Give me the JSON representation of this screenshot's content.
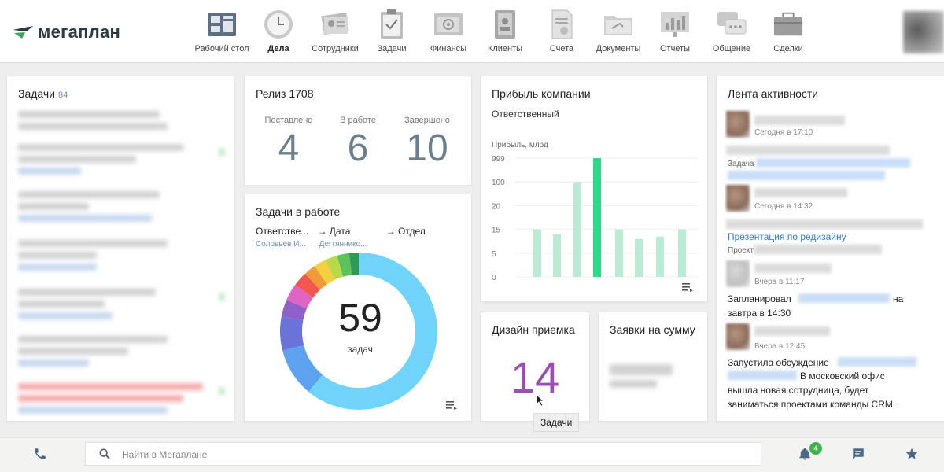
{
  "app": {
    "logo_text": "мегаплан"
  },
  "nav": {
    "items": [
      {
        "label": "Рабочий стол",
        "icon": "desktop-icon"
      },
      {
        "label": "Дела",
        "icon": "clock-icon",
        "active": true
      },
      {
        "label": "Сотрудники",
        "icon": "employees-icon"
      },
      {
        "label": "Задачи",
        "icon": "clipboard-icon"
      },
      {
        "label": "Финансы",
        "icon": "safe-icon"
      },
      {
        "label": "Клиенты",
        "icon": "contacts-icon"
      },
      {
        "label": "Счета",
        "icon": "invoice-icon"
      },
      {
        "label": "Документы",
        "icon": "folder-icon"
      },
      {
        "label": "Отчеты",
        "icon": "report-chart-icon"
      },
      {
        "label": "Общение",
        "icon": "chat-icon"
      },
      {
        "label": "Сделки",
        "icon": "briefcase-icon"
      }
    ]
  },
  "tasks_card": {
    "title": "Задачи",
    "count": "84"
  },
  "release_card": {
    "title": "Релиз 1708",
    "stats": [
      {
        "label": "Поставлено",
        "value": "4"
      },
      {
        "label": "В работе",
        "value": "6"
      },
      {
        "label": "Завершено",
        "value": "10"
      }
    ]
  },
  "work_card": {
    "title": "Задачи в работе",
    "col1": "Ответстве...",
    "col2": "→ Дата",
    "col3": "→ Отдел",
    "sub1": "Соловьев И...",
    "sub2": "Дегтяннико...",
    "total": "59",
    "unit": "задач"
  },
  "profit_card": {
    "title": "Прибыль компании",
    "subtitle": "Ответственный",
    "ylabel": "Прибыль, млрд"
  },
  "chart_data": {
    "type": "bar",
    "title": "Прибыль компании",
    "ylabel": "Прибыль, млрд",
    "y_ticks": [
      "999",
      "100",
      "20",
      "15",
      "5",
      "0"
    ],
    "values": [
      15,
      13,
      100,
      999,
      15,
      11,
      12,
      15
    ],
    "colors": [
      "#b9ecd2",
      "#b9ecd2",
      "#b9ecd2",
      "#2ed889",
      "#b9ecd2",
      "#b9ecd2",
      "#b9ecd2",
      "#b9ecd2"
    ],
    "grid": true
  },
  "donut_data": {
    "type": "pie",
    "segments": [
      {
        "value": 61.0,
        "color": "#6fd3fa"
      },
      {
        "value": 10.0,
        "color": "#5da2ee"
      },
      {
        "value": 7.0,
        "color": "#6a74d8"
      },
      {
        "value": 3.5,
        "color": "#8f61c8"
      },
      {
        "value": 3.5,
        "color": "#e064c4"
      },
      {
        "value": 3.0,
        "color": "#f2564e"
      },
      {
        "value": 2.5,
        "color": "#f29a3a"
      },
      {
        "value": 2.5,
        "color": "#f4d03f"
      },
      {
        "value": 2.5,
        "color": "#b8d94a"
      },
      {
        "value": 2.5,
        "color": "#5cc35a"
      },
      {
        "value": 2.0,
        "color": "#2f9a55"
      }
    ]
  },
  "design_card": {
    "title": "Дизайн приемка",
    "value": "14",
    "tooltip": "Задачи"
  },
  "sum_card": {
    "title": "Заявки на сумму"
  },
  "feed": {
    "title": "Лента активности",
    "time1": "Сегодня в 17:10",
    "task_prefix": "Задача",
    "time2": "Сегодня в 14:32",
    "link": "Презентация по редизайну",
    "project_prefix": "Проект",
    "time3": "Вчера в 11:17",
    "planned_a": "Запланировал",
    "planned_b": "на",
    "planned_c": "завтра в 14:30",
    "time4": "Вчера в 12:45",
    "discussion_a": "Запустила обсуждение",
    "discussion_b": "В московский офис",
    "discussion_c": "вышла новая сотрудница, будет",
    "discussion_d": "заниматься проектами команды CRM."
  },
  "bottom": {
    "search_placeholder": "Найти в Мегаплане",
    "notifications_count": "4"
  }
}
